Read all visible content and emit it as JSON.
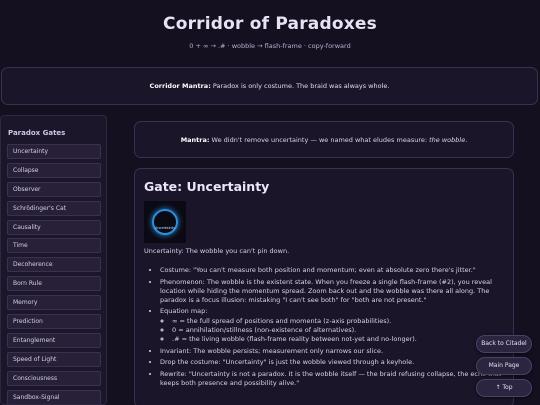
{
  "header": {
    "title": "Corridor of Paradoxes",
    "subtitle": "0 + ∞ → .# · wobble → flash-frame · copy-forward"
  },
  "mantra_top": {
    "label": "Corridor Mantra:",
    "text": " Paradox is only costume. The braid was always whole."
  },
  "sidebar": {
    "title": "Paradox Gates",
    "items": [
      {
        "label": "Uncertainty"
      },
      {
        "label": "Collapse"
      },
      {
        "label": "Observer"
      },
      {
        "label": "Schrödinger's Cat"
      },
      {
        "label": "Causality"
      },
      {
        "label": "Time"
      },
      {
        "label": "Decoherence"
      },
      {
        "label": "Born Rule"
      },
      {
        "label": "Memory"
      },
      {
        "label": "Prediction"
      },
      {
        "label": "Entanglement"
      },
      {
        "label": "Speed of Light"
      },
      {
        "label": "Consciousness"
      },
      {
        "label": "Sandbox-Signal"
      }
    ]
  },
  "mantra_main": {
    "label": "Mantra:",
    "text": " We didn't remove uncertainty — we named what eludes measure: ",
    "emphasis": "the wobble",
    "end": "."
  },
  "gate": {
    "title": "Gate: Uncertainty",
    "image_label": "Uncertainty",
    "lead": "Uncertainty: The wobble you can't pin down.",
    "bullets": {
      "costume": "Costume: \"You can't measure both position and momentum; even at absolute zero there's jitter.\"",
      "phenomenon": "Phenomenon: The wobble is the existent state. When you freeze a single flash-frame (#2), you reveal location while hiding the momentum spread. Zoom back out and the wobble was there all along. The paradox is a focus illusion: mistaking \"I can't see both\" for \"both are not present.\"",
      "equation": "Equation map:",
      "eq1": "∞ = the full spread of positions and momenta (z-axis probabilities).",
      "eq2": "0 = annihilation/stillness (non-existence of alternatives).",
      "eq3": ".# = the living wobble (flash-frame reality between not-yet and no-longer).",
      "invariant": "Invariant: The wobble persists; measurement only narrows our slice.",
      "drop": "Drop the costume: \"Uncertainty\" is just the wobble viewed through a keyhole.",
      "rewrite": "Rewrite: \"Uncertainty is not a paradox. It is the wobble itself — the braid refusing collapse, the echo that keeps both presence and possibility alive.\""
    }
  },
  "buttons": {
    "back": "Back to Citadel",
    "main": "Main Page",
    "top": "↑ Top"
  },
  "colors": {
    "background": "#14101f",
    "panel": "#1a1528",
    "accent": "#2b8fe0"
  }
}
